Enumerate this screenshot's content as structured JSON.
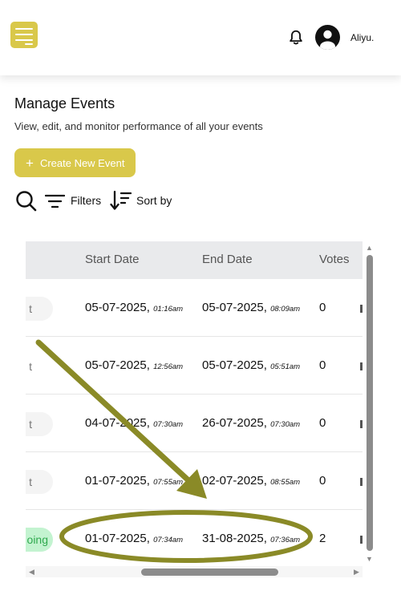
{
  "header": {
    "menu_icon": "hamburger-icon",
    "notification_icon": "bell-icon",
    "avatar_icon": "user-circle-icon",
    "username": "Aliyu."
  },
  "page": {
    "title": "Manage Events",
    "subtitle": "View, edit, and monitor performance of all your events"
  },
  "actions": {
    "create_icon": "plus-icon",
    "create_label": "Create New Event",
    "search_icon": "search-icon",
    "filters_icon": "filter-icon",
    "filters_label": "Filters",
    "sort_icon": "sort-descending-icon",
    "sort_label": "Sort by"
  },
  "table": {
    "columns": [
      "Start Date",
      "End Date",
      "Votes"
    ],
    "rows": [
      {
        "status": "t",
        "start_date": "05-07-2025,",
        "start_time": "01:16am",
        "end_date": "05-07-2025,",
        "end_time": "08:09am",
        "votes": "0"
      },
      {
        "status": "t",
        "start_date": "05-07-2025,",
        "start_time": "12:56am",
        "end_date": "05-07-2025,",
        "end_time": "05:51am",
        "votes": "0"
      },
      {
        "status": "t",
        "start_date": "04-07-2025,",
        "start_time": "07:30am",
        "end_date": "26-07-2025,",
        "end_time": "07:30am",
        "votes": "0"
      },
      {
        "status": "t",
        "start_date": "01-07-2025,",
        "start_time": "07:55am",
        "end_date": "02-07-2025,",
        "end_time": "08:55am",
        "votes": "0"
      },
      {
        "status": "oing",
        "start_date": "01-07-2025,",
        "start_time": "07:34am",
        "end_date": "31-08-2025,",
        "end_time": "07:36am",
        "votes": "2"
      }
    ]
  },
  "colors": {
    "accent": "#d9c84a",
    "annotation": "#8a8a27",
    "status_green_bg": "#c3f3d0",
    "status_green_text": "#2fa94e"
  }
}
